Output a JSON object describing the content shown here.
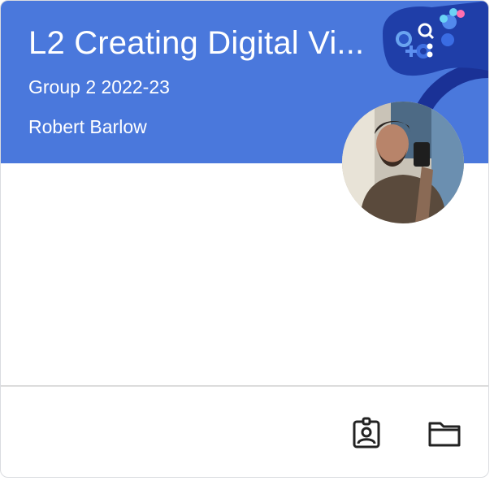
{
  "class_card": {
    "title": "L2 Creating Digital Vi...",
    "section": "Group 2 2022-23",
    "teacher": "Robert Barlow",
    "colors": {
      "header": "#4a78dc",
      "art_dark": "#1f3ea8",
      "art_ring": "#1a3196",
      "accent_pink": "#ff6fb0",
      "accent_cyan": "#6ad3f5"
    }
  },
  "footer": {
    "icons": [
      "assignment-ind-icon",
      "folder-icon"
    ]
  }
}
